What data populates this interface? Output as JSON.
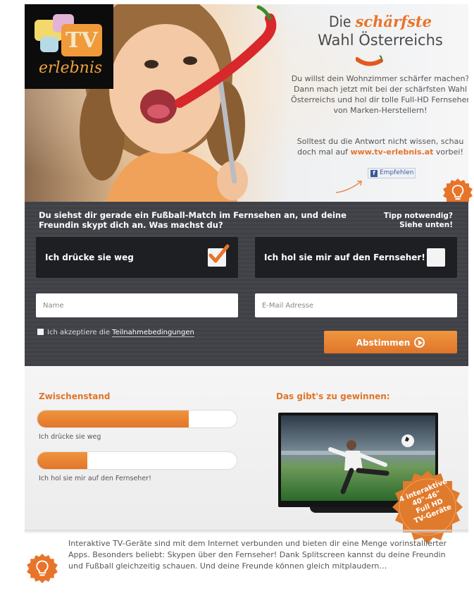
{
  "brand": {
    "logo_tv": "TV",
    "logo_sub": "erlebnis"
  },
  "hero": {
    "headline_prefix": "Die ",
    "headline_spicy": "schärfste",
    "headline_line2": "Wahl Österreichs",
    "intro": "Du willst dein Wohnzimmer schärfer machen? Dann mach jetzt mit bei der schärfsten Wahl Österreichs und hol dir tolle Full-HD Fernseher von Marken-Herstellern!",
    "hint_prefix": "Solltest du die Antwort nicht wissen, schau doch mal auf ",
    "hint_url": "www.tv-erlebnis.at",
    "hint_suffix": " vorbei!",
    "fb_label": "Empfehlen",
    "fb_logo": "f"
  },
  "quiz": {
    "question": "Du siehst dir gerade ein Fußball-Match im Fernsehen an, und deine Freundin skypt dich an. Was machst du?",
    "tip_line1": "Tipp notwendig?",
    "tip_line2": "Siehe unten!",
    "answers": [
      {
        "label": "Ich drücke sie weg",
        "checked": true
      },
      {
        "label": "Ich hol sie mir auf den Fernseher!",
        "checked": false
      }
    ],
    "name_placeholder": "Name",
    "email_placeholder": "E-Mail Adresse",
    "terms_prefix": "Ich akzeptiere die ",
    "terms_link": "Teilnahmebedingungen",
    "vote_label": "Abstimmen"
  },
  "results": {
    "title": "Zwischenstand",
    "bars": [
      {
        "label": "Ich drücke sie weg",
        "fraction": 0.76
      },
      {
        "label": "Ich hol sie mir auf den Fernseher!",
        "fraction": 0.25
      }
    ]
  },
  "prize": {
    "title": "Das gibt's zu gewinnen:",
    "seal_lines": [
      "4 interaktive",
      "40\"-46\"",
      "Full HD",
      "TV-Geräte"
    ]
  },
  "footer": {
    "text": "Interaktive TV-Geräte sind mit dem Internet verbunden und bieten dir eine Menge vorinstallierter Apps. Besonders beliebt: Skypen über den Fernseher! Dank Splitscreen kannst du deine Freundin und Fußball gleichzeitig schauen. Und deine Freunde können gleich mitplaudern…"
  },
  "colors": {
    "accent": "#e8742a",
    "panel": "#404248",
    "answer_bg": "#1e1f22"
  }
}
